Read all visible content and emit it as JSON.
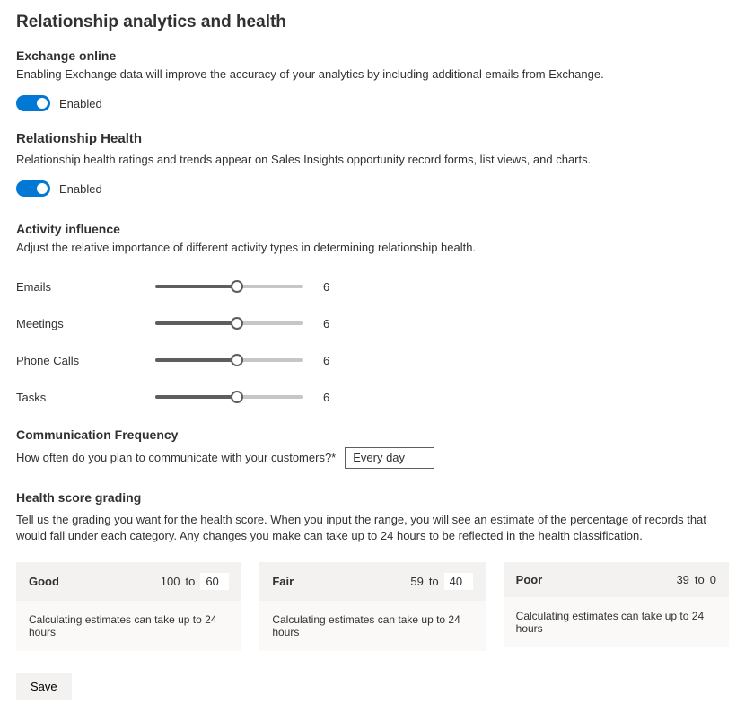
{
  "page": {
    "title": "Relationship analytics and health"
  },
  "exchange": {
    "title": "Exchange online",
    "desc": "Enabling Exchange data will improve the accuracy of your analytics by including additional emails from Exchange.",
    "toggle_label": "Enabled",
    "toggle_on": true
  },
  "health": {
    "title": "Relationship Health",
    "desc": "Relationship health ratings and trends appear on Sales Insights opportunity record forms, list views, and charts.",
    "toggle_label": "Enabled",
    "toggle_on": true
  },
  "activity": {
    "title": "Activity influence",
    "desc": "Adjust the relative importance of different activity types in determining relationship health.",
    "sliders": {
      "emails": {
        "label": "Emails",
        "value": "6",
        "pct": 55
      },
      "meetings": {
        "label": "Meetings",
        "value": "6",
        "pct": 55
      },
      "phone": {
        "label": "Phone Calls",
        "value": "6",
        "pct": 55
      },
      "tasks": {
        "label": "Tasks",
        "value": "6",
        "pct": 55
      }
    }
  },
  "communication": {
    "title": "Communication Frequency",
    "label": "How often do you plan to communicate with your customers?*",
    "selected": "Every day"
  },
  "grading": {
    "title": "Health score grading",
    "desc": "Tell us the grading you want for the health score. When you input the range, you will see an estimate of the percentage of records that would fall under each category. Any changes you make can take up to 24 hours to be reflected in the health classification.",
    "cards": {
      "good": {
        "label": "Good",
        "high": "100",
        "to": "to",
        "input": "60",
        "note": "Calculating estimates can take up to 24 hours"
      },
      "fair": {
        "label": "Fair",
        "high": "59",
        "to": "to",
        "input": "40",
        "note": "Calculating estimates can take up to 24 hours"
      },
      "poor": {
        "label": "Poor",
        "high": "39",
        "to": "to",
        "low": "0",
        "note": "Calculating estimates can take up to 24 hours"
      }
    }
  },
  "footer": {
    "save": "Save"
  }
}
